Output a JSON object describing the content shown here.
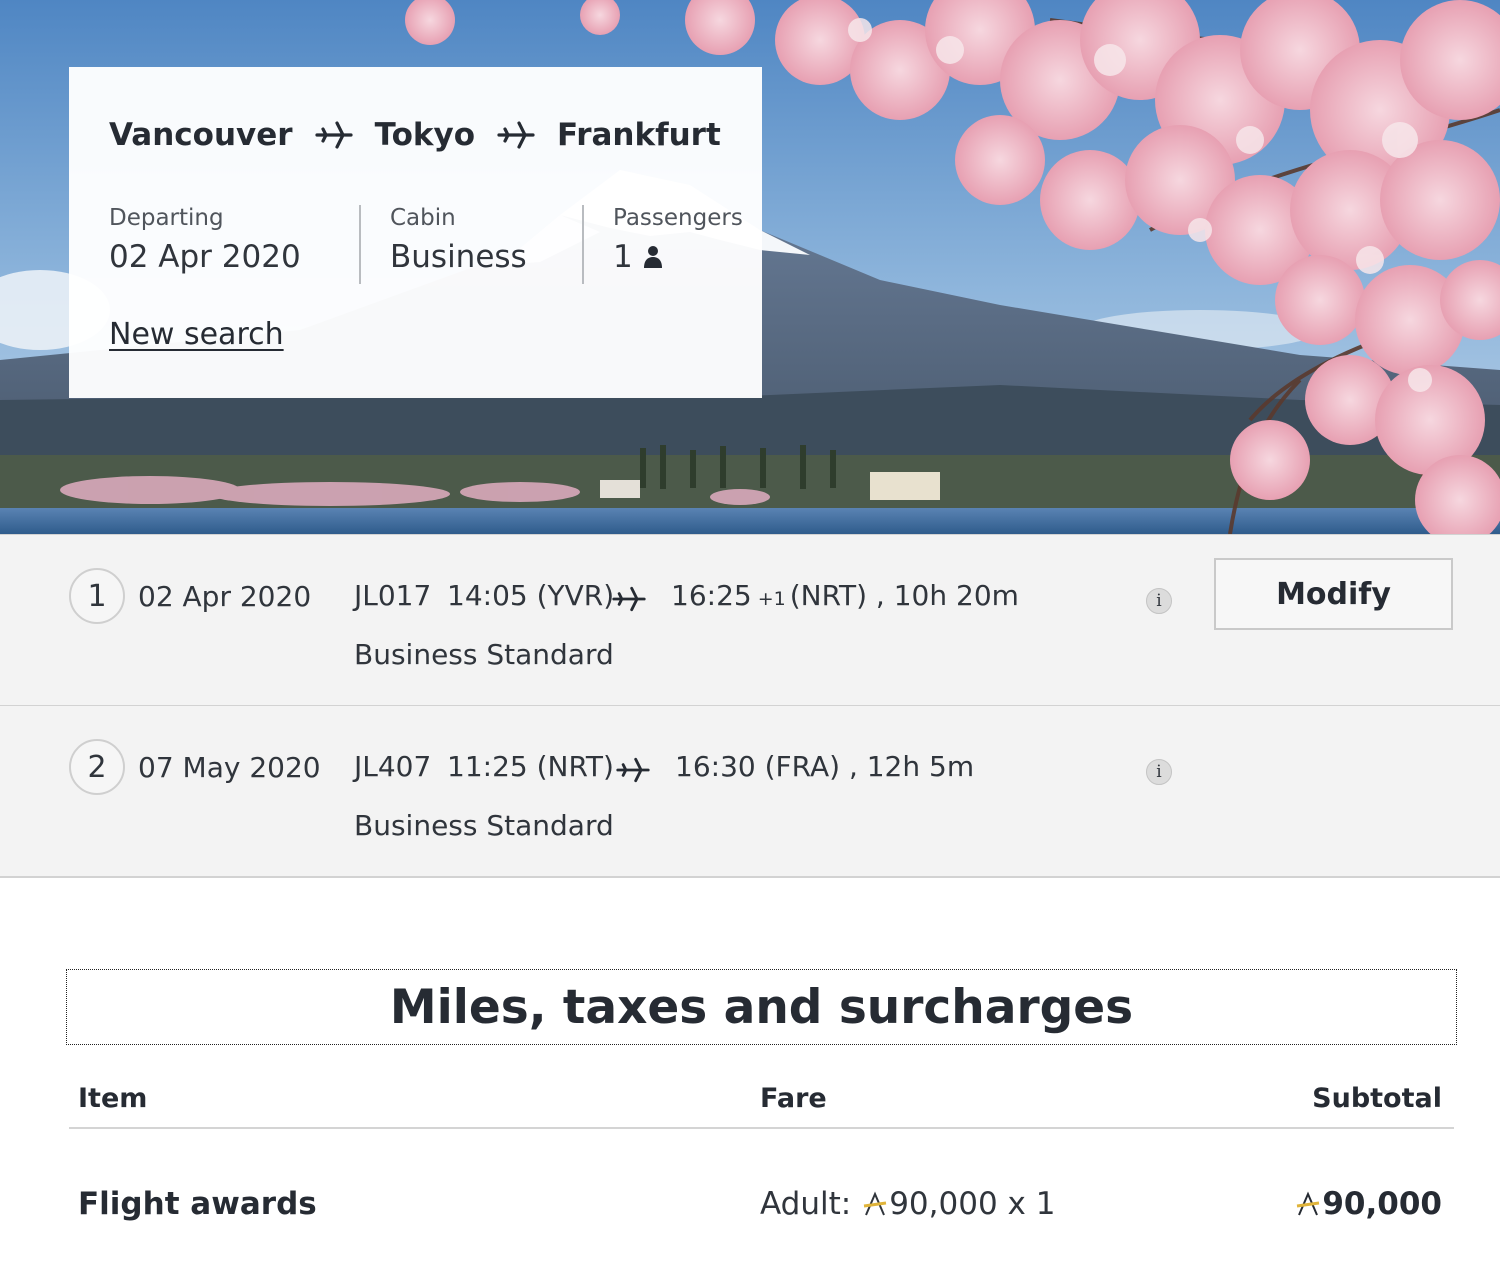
{
  "search": {
    "origin": "Vancouver",
    "via": "Tokyo",
    "destination": "Frankfurt",
    "departing_label": "Departing",
    "departing_value": "02 Apr 2020",
    "cabin_label": "Cabin",
    "cabin_value": "Business",
    "passengers_label": "Passengers",
    "passengers_value": "1",
    "passenger_icon": "person-icon",
    "new_search": "New search"
  },
  "legs": [
    {
      "number": "1",
      "date": "02 Apr 2020",
      "flight": "JL017",
      "departure": "14:05 (YVR)",
      "arrival_time": "16:25",
      "day_offset": "+1",
      "arrival_rest": "(NRT) , 10h 20m",
      "fare_class": "Business Standard",
      "info": "i",
      "modify": "Modify"
    },
    {
      "number": "2",
      "date": "07 May 2020",
      "flight": "JL407",
      "departure": "11:25 (NRT)",
      "arrival_time": "16:30",
      "day_offset": "",
      "arrival_rest": "(FRA) , 12h 5m",
      "fare_class": "Business Standard",
      "info": "i"
    }
  ],
  "summary": {
    "title": "Miles, taxes and surcharges",
    "columns": {
      "item": "Item",
      "fare": "Fare",
      "subtotal": "Subtotal"
    },
    "rows": [
      {
        "item": "Flight awards",
        "fare_prefix": "Adult:",
        "fare_value": "90,000 x 1",
        "subtotal": "90,000"
      }
    ]
  },
  "colors": {
    "card_bg": "#ffffff",
    "leg_bg": "#f3f3f3",
    "text": "#262b33",
    "miles_icon_accent": "#e0b43a"
  }
}
